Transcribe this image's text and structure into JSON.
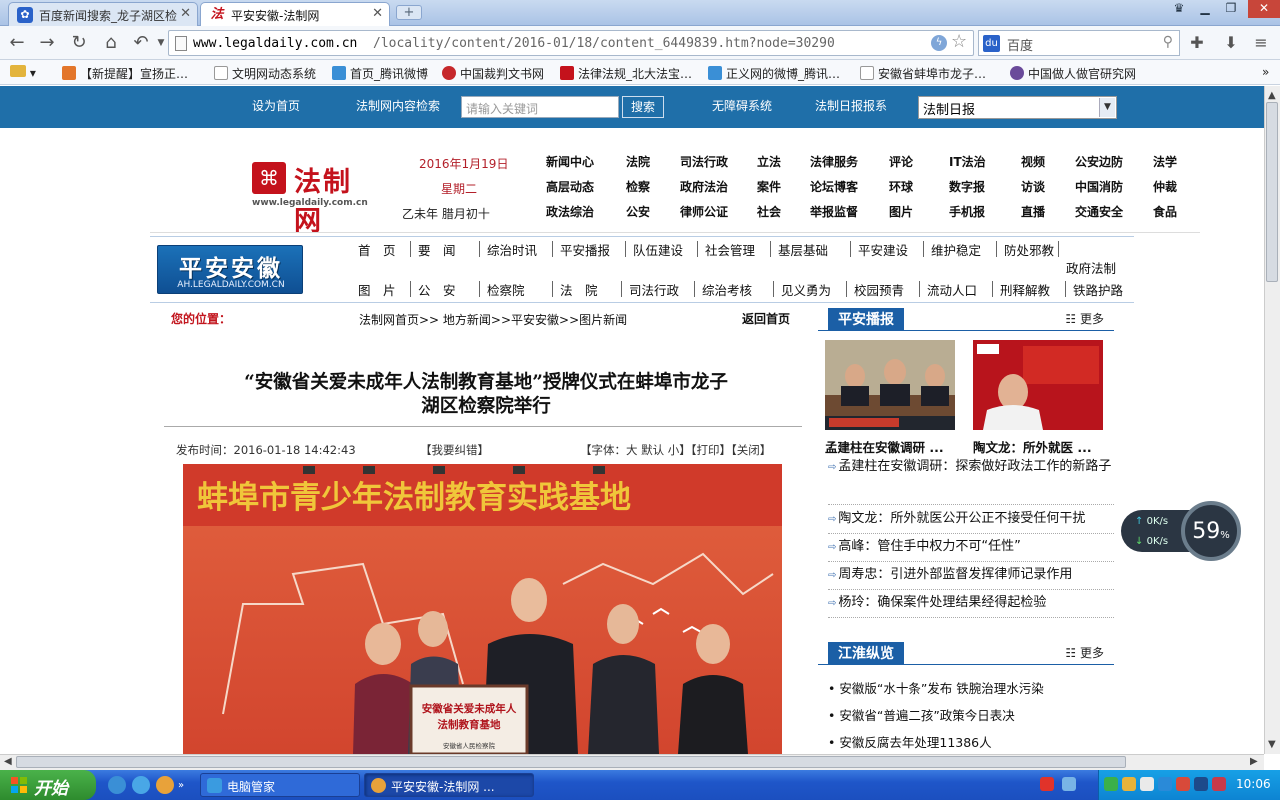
{
  "browser": {
    "tabs": [
      {
        "title": "百度新闻搜索_龙子湖区检",
        "icon": "paw-icon"
      },
      {
        "title": "平安安徽-法制网",
        "icon": "fa-icon"
      }
    ],
    "new_tab": "+",
    "url_host": "www.legaldaily.com.cn",
    "url_path": "/locality/content/2016-01/18/content_6449839.htm?node=30290",
    "search_placeholder": "百度"
  },
  "bookmarks": [
    "【新提醒】宣扬正…",
    "文明网动态系统",
    "首页_腾讯微博",
    "中国裁判文书网",
    "法律法规_北大法宝…",
    "正义网的微博_腾讯…",
    "安徽省蚌埠市龙子…",
    "中国做人做官研究网"
  ],
  "topstrip": {
    "home": "设为首页",
    "search_label": "法制网内容检索",
    "input_placeholder": "请输入关键词",
    "search_btn": "搜索",
    "accessible": "无障碍系统",
    "newspaper": "法制日报报系",
    "select_value": "法制日报"
  },
  "header": {
    "logo_name": "法制网",
    "logo_url": "www.legaldaily.com.cn",
    "date": "2016年1月19日",
    "weekday": "星期二",
    "lunar": "乙未年 腊月初十",
    "nav": [
      [
        "新闻中心",
        "法院",
        "司法行政",
        "立法",
        "法律服务",
        "评论",
        "IT法治",
        "视频",
        "公安边防",
        "法学"
      ],
      [
        "高层动态",
        "检察",
        "政府法治",
        "案件",
        "论坛博客",
        "环球",
        "数字报",
        "访谈",
        "中国消防",
        "仲裁"
      ],
      [
        "政法综治",
        "公安",
        "律师公证",
        "社会",
        "举报监督",
        "图片",
        "手机报",
        "直播",
        "交通安全",
        "食品"
      ]
    ]
  },
  "channel": {
    "logo_name": "平安安徽",
    "logo_url": "AH.LEGALDAILY.COM.CN",
    "row1": [
      "首　页",
      "要　闻",
      "综治时讯",
      "平安播报",
      "队伍建设",
      "社会管理",
      "基层基础",
      "平安建设",
      "维护稳定",
      "防处邪教",
      "政府法制"
    ],
    "row2": [
      "图　片",
      "公　安",
      "检察院",
      "法　院",
      "司法行政",
      "综治考核",
      "见义勇为",
      "校园预青",
      "流动人口",
      "刑释解教",
      "铁路护路"
    ]
  },
  "breadcrumb": {
    "label": "您的位置：",
    "path": "法制网首页>>  地方新闻>>平安安徽>>图片新闻",
    "back": "返回首页"
  },
  "article": {
    "title_line1": "“安徽省关爱未成年人法制教育基地”授牌仪式在蚌埠市龙子",
    "title_line2": "湖区检察院举行",
    "time": "发布时间：2016-01-18 14:42:43",
    "report": "【我要纠错】",
    "tools": "【字体：大 默认 小】【打印】【关闭】",
    "photo_banner": "蚌埠市青少年法制教育实践基地",
    "plaque_line1": "安徽省关爱未成年人",
    "plaque_line2": "法制教育基地",
    "plaque_issuer": "安徽省人民检察院"
  },
  "sidebar": {
    "panel1": {
      "title": "平安播报",
      "more": "更多",
      "thumbs": [
        "孟建柱在安徽调研 ...",
        "陶文龙：所外就医 ..."
      ],
      "items": [
        "孟建柱在安徽调研：探索做好政法工作的新路子",
        "陶文龙：所外就医公开公正不接受任何干扰",
        "高峰：管住手中权力不可“任性”",
        "周寿忠：引进外部监督发挥律师记录作用",
        "杨玲：确保案件处理结果经得起检验"
      ]
    },
    "panel2": {
      "title": "江淮纵览",
      "more": "更多",
      "items": [
        "安徽版“水十条”发布 铁腕治理水污染",
        "安徽省“普遍二孩”政策今日表决",
        "安徽反腐去年处理11386人"
      ]
    }
  },
  "speed_widget": {
    "up": "0K/s",
    "down": "0K/s",
    "percent": "59",
    "percent_unit": "%"
  },
  "taskbar": {
    "start": "开始",
    "tasks": [
      "电脑管家",
      "平安安徽-法制网 ..."
    ],
    "clock": "10:06"
  }
}
